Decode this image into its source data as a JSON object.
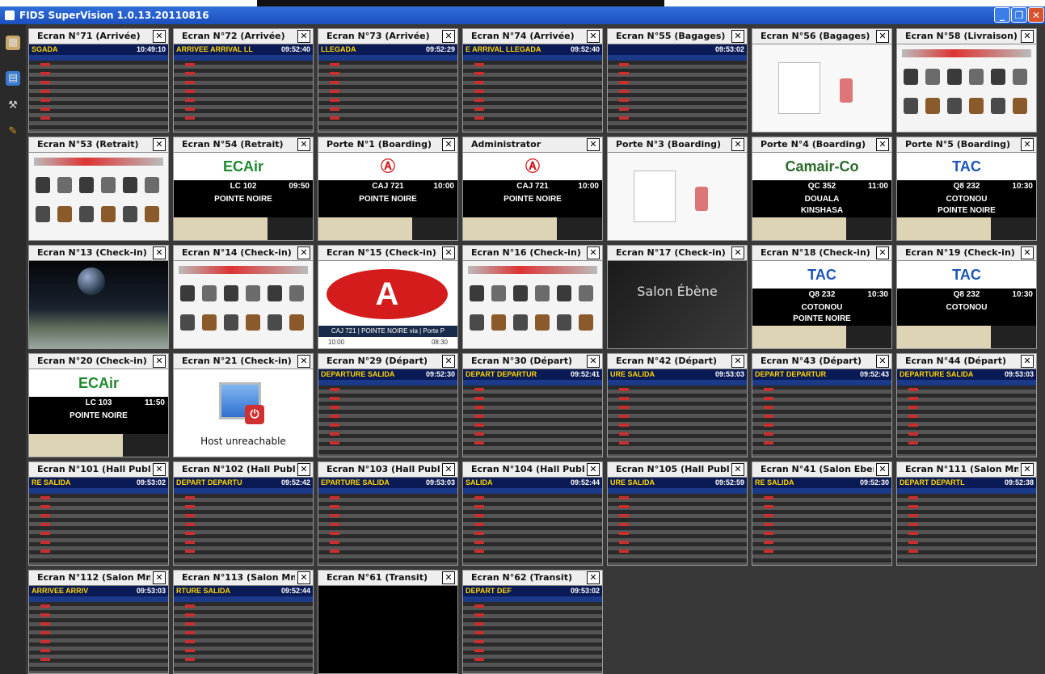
{
  "window": {
    "title": "FIDS SuperVision 1.0.13.20110816",
    "controls": [
      "_",
      "❐",
      "✕"
    ]
  },
  "tiles": [
    {
      "title": "Ecran N°71 (Arrivée)",
      "kind": "board",
      "header": "SGADA",
      "time": "10:49:10"
    },
    {
      "title": "Ecran N°72 (Arrivée)",
      "kind": "board",
      "header": "ARRIVEE ARRIVAL LL",
      "time": "09:52:40"
    },
    {
      "title": "Ecran N°73 (Arrivée)",
      "kind": "board",
      "header": "LLEGADA",
      "time": "09:52:29"
    },
    {
      "title": "Ecran N°74 (Arrivée)",
      "kind": "board",
      "header": "E ARRIVAL LLEGADA",
      "time": "09:52:40"
    },
    {
      "title": "Ecran N°55 (Bagages)",
      "kind": "board",
      "header": "",
      "time": "09:53:02"
    },
    {
      "title": "Ecran N°56 (Bagages)",
      "kind": "bagage"
    },
    {
      "title": "Ecran N°58 (Livraison)",
      "kind": "items"
    },
    {
      "title": "Ecran N°53 (Retrait)",
      "kind": "items"
    },
    {
      "title": "Ecran N°54 (Retrait)",
      "kind": "boarding",
      "logo": "ECAir",
      "flight": "LC 102",
      "time": "09:50",
      "dest": "POINTE NOIRE",
      "dest2": ""
    },
    {
      "title": "Porte N°1 (Boarding)",
      "kind": "boarding",
      "logo": "Ⓐ",
      "flight": "CAJ 721",
      "time": "10:00",
      "dest": "POINTE NOIRE",
      "dest2": ""
    },
    {
      "title": "Administrator",
      "kind": "boarding",
      "logo": "Ⓐ",
      "flight": "CAJ 721",
      "time": "10:00",
      "dest": "POINTE NOIRE",
      "dest2": ""
    },
    {
      "title": "Porte N°3 (Boarding)",
      "kind": "bagage"
    },
    {
      "title": "Porte N°4 (Boarding)",
      "kind": "boarding",
      "logo": "Camair-Co",
      "flight": "QC 352",
      "time": "11:00",
      "dest": "DOUALA",
      "dest2": "KINSHASA"
    },
    {
      "title": "Porte N°5 (Boarding)",
      "kind": "boarding",
      "logo": "TAC",
      "flight": "Q8 232",
      "time": "10:30",
      "dest": "COTONOU",
      "dest2": "POINTE NOIRE"
    },
    {
      "title": "Ecran N°13 (Check-in)",
      "kind": "earth"
    },
    {
      "title": "Ecran N°14 (Check-in)",
      "kind": "items"
    },
    {
      "title": "Ecran N°15 (Check-in)",
      "kind": "caj",
      "caption": "CAJ 721 | POINTE NOIRE via | Porte P",
      "t1": "10:00",
      "t2": "08:30"
    },
    {
      "title": "Ecran N°16 (Check-in)",
      "kind": "items"
    },
    {
      "title": "Ecran N°17 (Check-in)",
      "kind": "salon",
      "text": "Salon Ébène"
    },
    {
      "title": "Ecran N°18 (Check-in)",
      "kind": "boarding",
      "logo": "TAC",
      "flight": "Q8 232",
      "time": "10:30",
      "dest": "COTONOU",
      "dest2": "POINTE NOIRE"
    },
    {
      "title": "Ecran N°19 (Check-in)",
      "kind": "boarding",
      "logo": "TAC",
      "flight": "Q8 232",
      "time": "10:30",
      "dest": "COTONOU",
      "dest2": ""
    },
    {
      "title": "Ecran N°20 (Check-in)",
      "kind": "boarding",
      "logo": "ECAir",
      "flight": "LC 103",
      "time": "11:50",
      "dest": "POINTE NOIRE",
      "dest2": ""
    },
    {
      "title": "Ecran N°21 (Check-in)",
      "kind": "unreach",
      "text": "Host unreachable"
    },
    {
      "title": "Ecran N°29 (Départ)",
      "kind": "board",
      "header": "DEPARTURE SALIDA",
      "time": "09:52:30"
    },
    {
      "title": "Ecran N°30 (Départ)",
      "kind": "board",
      "header": "DEPART DEPARTUR",
      "time": "09:52:41"
    },
    {
      "title": "Ecran N°42 (Départ)",
      "kind": "board",
      "header": "URE SALIDA",
      "time": "09:53:03"
    },
    {
      "title": "Ecran N°43 (Départ)",
      "kind": "board",
      "header": "DEPART DEPARTUR",
      "time": "09:52:43"
    },
    {
      "title": "Ecran N°44 (Départ)",
      "kind": "board",
      "header": "DEPARTURE SALIDA",
      "time": "09:53:03"
    },
    {
      "title": "Ecran N°101 (Hall Public -",
      "kind": "board",
      "header": "RE SALIDA",
      "time": "09:53:02"
    },
    {
      "title": "Ecran N°102 (Hall Public -",
      "kind": "board",
      "header": "DEPART DEPARTU",
      "time": "09:52:42"
    },
    {
      "title": "Ecran N°103 (Hall Public -",
      "kind": "board",
      "header": "EPARTURE SALIDA",
      "time": "09:53:03"
    },
    {
      "title": "Ecran N°104 (Hall Public -",
      "kind": "board",
      "header": "SALIDA",
      "time": "09:52:44"
    },
    {
      "title": "Ecran N°105 (Hall Public -",
      "kind": "board",
      "header": "URE SALIDA",
      "time": "09:52:59"
    },
    {
      "title": "Ecran N°41 (Salon Ebene)",
      "kind": "board",
      "header": "RE SALIDA",
      "time": "09:52:30"
    },
    {
      "title": "Ecran N°111 (Salon Mniste",
      "kind": "board",
      "header": "DEPART DEPARTL",
      "time": "09:52:38"
    },
    {
      "title": "Ecran N°112 (Salon Mniste",
      "kind": "board",
      "header": "ARRIVEE ARRIV",
      "time": "09:53:03"
    },
    {
      "title": "Ecran N°113 (Salon Mniste",
      "kind": "board",
      "header": "RTURE SALIDA",
      "time": "09:52:44"
    },
    {
      "title": "Ecran N°61 (Transit)",
      "kind": "black"
    },
    {
      "title": "Ecran N°62 (Transit)",
      "kind": "board",
      "header": "DEPART DEF",
      "time": "09:53:02"
    }
  ]
}
